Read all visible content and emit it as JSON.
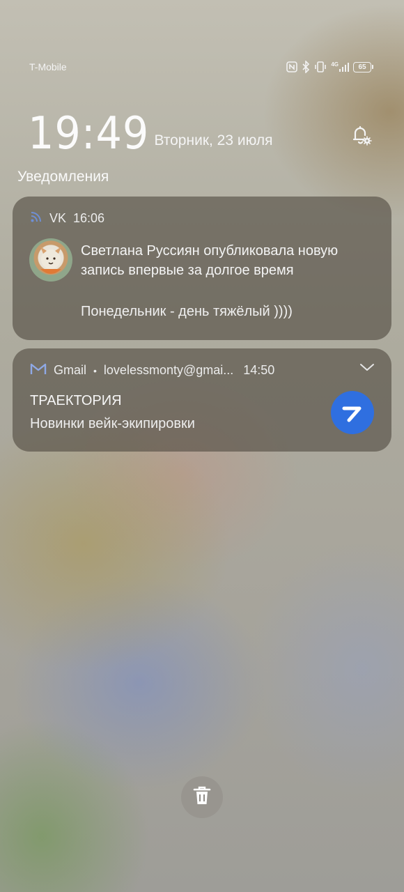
{
  "status_bar": {
    "carrier": "T-Mobile",
    "network_type": "4G",
    "battery_level": "65",
    "icons": [
      "nfc-icon",
      "bluetooth-icon",
      "vibrate-icon",
      "signal-icon",
      "battery-icon"
    ]
  },
  "lockscreen": {
    "time": "19:49",
    "date": "Вторник, 23 июля",
    "settings_icon": "bell-settings-icon"
  },
  "notifications": {
    "section_title": "Уведомления",
    "items": [
      {
        "app": "VK",
        "time": "16:06",
        "app_icon": "rss-icon",
        "title": "Светлана Руссиян опубликовала новую запись впервые за долгое время",
        "body": "Понедельник - день тяжёлый ))))"
      },
      {
        "app": "Gmail",
        "separator": "•",
        "account": "lovelessmonty@gmai...",
        "time": "14:50",
        "app_icon": "gmail-icon",
        "title": "ТРАЕКТОРИЯ",
        "body": "Новинки вейк-экипировки",
        "expand_icon": "chevron-down-icon"
      }
    ]
  },
  "actions": {
    "clear_icon": "trash-icon"
  },
  "colors": {
    "gmail_badge": "#2f6fe0",
    "card_bg": "#504a40"
  }
}
